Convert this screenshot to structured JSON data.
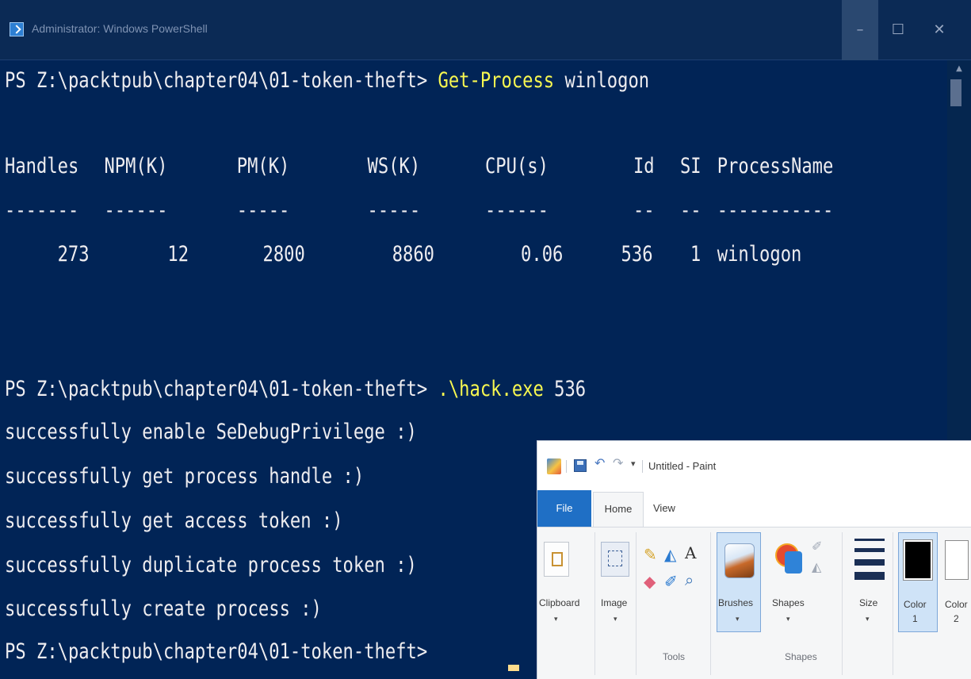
{
  "powershell": {
    "title": "Administrator: Windows PowerShell",
    "window_buttons": {
      "minimize": "–",
      "maximize": "☐",
      "close": "✕"
    },
    "colors": {
      "background": "#012456",
      "text": "#EEEDF0",
      "command": "#F7F750",
      "cursor": "#FEDC8C"
    },
    "prompt": "PS Z:\\packtpub\\chapter04\\01-token-theft> ",
    "command1": {
      "name": "Get-Process",
      "args": " winlogon"
    },
    "table": {
      "headers": [
        "Handles",
        "NPM(K)",
        "PM(K)",
        "WS(K)",
        "CPU(s)",
        "Id",
        "SI",
        "ProcessName"
      ],
      "separators": [
        "-------",
        "------",
        "-----",
        "-----",
        "------",
        "--",
        "--",
        "-----------"
      ],
      "row": [
        "273",
        "12",
        "2800",
        "8860",
        "0.06",
        "536",
        "1",
        "winlogon"
      ]
    },
    "command2": {
      "name": ".\\hack.exe",
      "args": " 536"
    },
    "output": [
      "successfully enable SeDebugPrivilege :)",
      "successfully get process handle :)",
      "successfully get access token :)",
      "successfully duplicate process token :)",
      "successfully create process :)"
    ]
  },
  "paint": {
    "title": "Untitled - Paint",
    "tabs": {
      "file": "File",
      "home": "Home",
      "view": "View"
    },
    "buttons": {
      "clipboard": "Clipboard",
      "image": "Image",
      "brushes": "Brushes",
      "shapes": "Shapes",
      "size": "Size",
      "color1": "Color\n1",
      "color2": "Color\n2"
    },
    "groups": {
      "tools": "Tools",
      "shapes": "Shapes"
    },
    "colors": {
      "file_tab": "#1F6FC5",
      "selected": "#CFE3F7",
      "color1": "#000000",
      "color2": "#FFFFFF"
    }
  }
}
